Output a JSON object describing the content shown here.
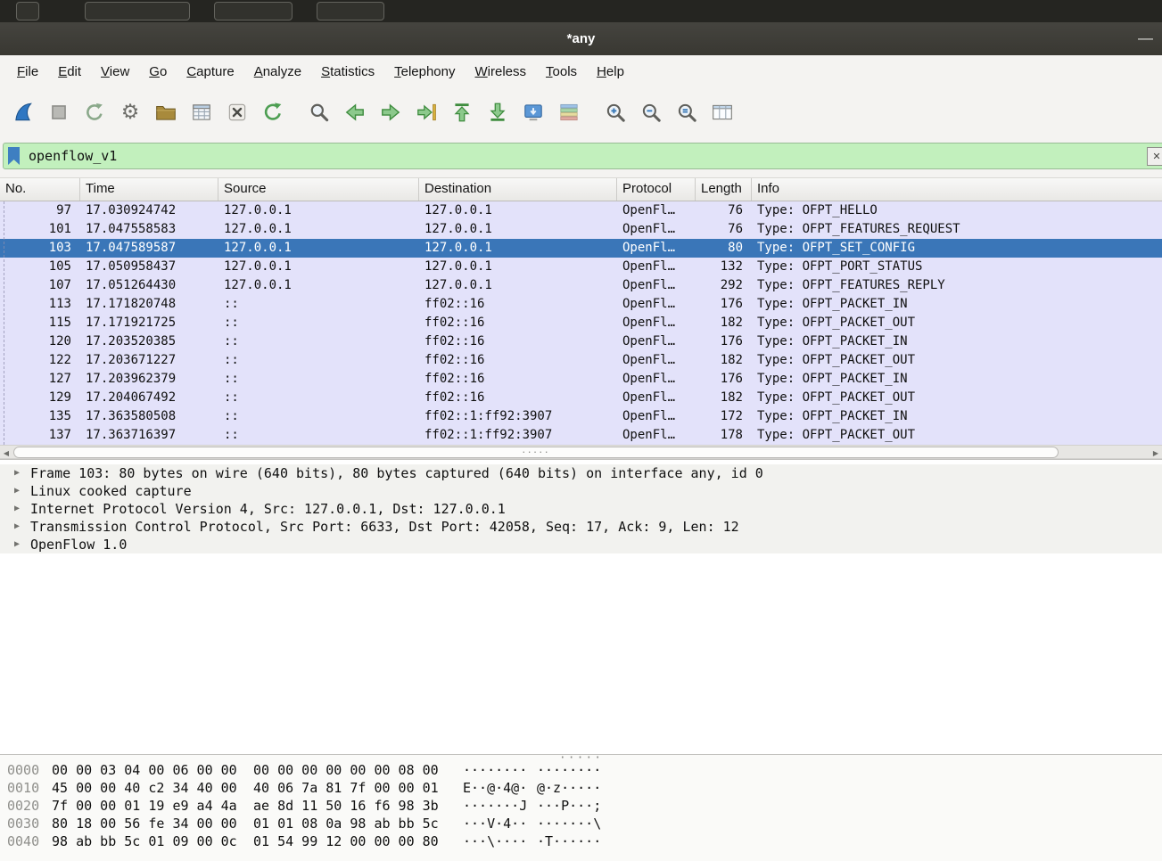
{
  "window": {
    "title": "*any",
    "minimize": "—"
  },
  "background_window": {
    "button_count": 4
  },
  "menu": {
    "items": [
      "File",
      "Edit",
      "View",
      "Go",
      "Capture",
      "Analyze",
      "Statistics",
      "Telephony",
      "Wireless",
      "Tools",
      "Help"
    ]
  },
  "toolbar": {
    "icons": [
      "start-capture",
      "stop-capture",
      "restart-capture",
      "capture-options",
      "open-file",
      "save-file",
      "close-file",
      "reload",
      "find-packet",
      "go-back",
      "go-forward",
      "go-to-packet",
      "go-to-top",
      "go-to-bottom",
      "auto-scroll",
      "colorize",
      "zoom-in",
      "zoom-out",
      "zoom-original",
      "resize-columns"
    ]
  },
  "filter": {
    "value": "openflow_v1",
    "bookmark_icon": "bookmark-icon",
    "apply_glyph": "✕"
  },
  "packet_list": {
    "columns": [
      "No.",
      "Time",
      "Source",
      "Destination",
      "Protocol",
      "Length",
      "Info"
    ],
    "rows": [
      {
        "no": "97",
        "time": "17.030924742",
        "source": "127.0.0.1",
        "destination": "127.0.0.1",
        "protocol": "OpenFl…",
        "length": "76",
        "info": "Type: OFPT_HELLO"
      },
      {
        "no": "101",
        "time": "17.047558583",
        "source": "127.0.0.1",
        "destination": "127.0.0.1",
        "protocol": "OpenFl…",
        "length": "76",
        "info": "Type: OFPT_FEATURES_REQUEST"
      },
      {
        "no": "103",
        "time": "17.047589587",
        "source": "127.0.0.1",
        "destination": "127.0.0.1",
        "protocol": "OpenFl…",
        "length": "80",
        "info": "Type: OFPT_SET_CONFIG",
        "selected": true
      },
      {
        "no": "105",
        "time": "17.050958437",
        "source": "127.0.0.1",
        "destination": "127.0.0.1",
        "protocol": "OpenFl…",
        "length": "132",
        "info": "Type: OFPT_PORT_STATUS"
      },
      {
        "no": "107",
        "time": "17.051264430",
        "source": "127.0.0.1",
        "destination": "127.0.0.1",
        "protocol": "OpenFl…",
        "length": "292",
        "info": "Type: OFPT_FEATURES_REPLY"
      },
      {
        "no": "113",
        "time": "17.171820748",
        "source": "::",
        "destination": "ff02::16",
        "protocol": "OpenFl…",
        "length": "176",
        "info": "Type: OFPT_PACKET_IN"
      },
      {
        "no": "115",
        "time": "17.171921725",
        "source": "::",
        "destination": "ff02::16",
        "protocol": "OpenFl…",
        "length": "182",
        "info": "Type: OFPT_PACKET_OUT"
      },
      {
        "no": "120",
        "time": "17.203520385",
        "source": "::",
        "destination": "ff02::16",
        "protocol": "OpenFl…",
        "length": "176",
        "info": "Type: OFPT_PACKET_IN"
      },
      {
        "no": "122",
        "time": "17.203671227",
        "source": "::",
        "destination": "ff02::16",
        "protocol": "OpenFl…",
        "length": "182",
        "info": "Type: OFPT_PACKET_OUT"
      },
      {
        "no": "127",
        "time": "17.203962379",
        "source": "::",
        "destination": "ff02::16",
        "protocol": "OpenFl…",
        "length": "176",
        "info": "Type: OFPT_PACKET_IN"
      },
      {
        "no": "129",
        "time": "17.204067492",
        "source": "::",
        "destination": "ff02::16",
        "protocol": "OpenFl…",
        "length": "182",
        "info": "Type: OFPT_PACKET_OUT"
      },
      {
        "no": "135",
        "time": "17.363580508",
        "source": "::",
        "destination": "ff02::1:ff92:3907",
        "protocol": "OpenFl…",
        "length": "172",
        "info": "Type: OFPT_PACKET_IN"
      },
      {
        "no": "137",
        "time": "17.363716397",
        "source": "::",
        "destination": "ff02::1:ff92:3907",
        "protocol": "OpenFl…",
        "length": "178",
        "info": "Type: OFPT_PACKET_OUT"
      }
    ]
  },
  "details": {
    "expander": "▶",
    "rows": [
      "Frame 103: 80 bytes on wire (640 bits), 80 bytes captured (640 bits) on interface any, id 0",
      "Linux cooked capture",
      "Internet Protocol Version 4, Src: 127.0.0.1, Dst: 127.0.0.1",
      "Transmission Control Protocol, Src Port: 6633, Dst Port: 42058, Seq: 17, Ack: 9, Len: 12",
      "OpenFlow 1.0"
    ]
  },
  "hex": {
    "rows": [
      {
        "offset": "0000",
        "hex1": "00 00 03 04 00 06 00 00",
        "hex2": "00 00 00 00 00 00 08 00",
        "ascii1": "········",
        "ascii2": "········"
      },
      {
        "offset": "0010",
        "hex1": "45 00 00 40 c2 34 40 00",
        "hex2": "40 06 7a 81 7f 00 00 01",
        "ascii1": "E··@·4@·",
        "ascii2": "@·z·····"
      },
      {
        "offset": "0020",
        "hex1": "7f 00 00 01 19 e9 a4 4a",
        "hex2": "ae 8d 11 50 16 f6 98 3b",
        "ascii1": "·······J",
        "ascii2": "···P···;"
      },
      {
        "offset": "0030",
        "hex1": "80 18 00 56 fe 34 00 00",
        "hex2": "01 01 08 0a 98 ab bb 5c",
        "ascii1": "···V·4··",
        "ascii2": "·······\\"
      },
      {
        "offset": "0040",
        "hex1": "98 ab bb 5c 01 09 00 0c",
        "hex2": "01 54 99 12 00 00 00 80",
        "ascii1": "···\\····",
        "ascii2": "·T······"
      }
    ]
  },
  "scrollbar": {
    "left_arrow": "◀",
    "right_arrow": "▶",
    "grip": "·····"
  },
  "colors": {
    "titlebar_bg": "#3e3d39",
    "chrome_bg": "#f4f3f1",
    "filter_valid_bg": "#c2f0bd",
    "openflow_row_bg": "#e3e2fa",
    "selected_row_bg": "#3a76b8",
    "selected_row_text": "#ffffff"
  }
}
